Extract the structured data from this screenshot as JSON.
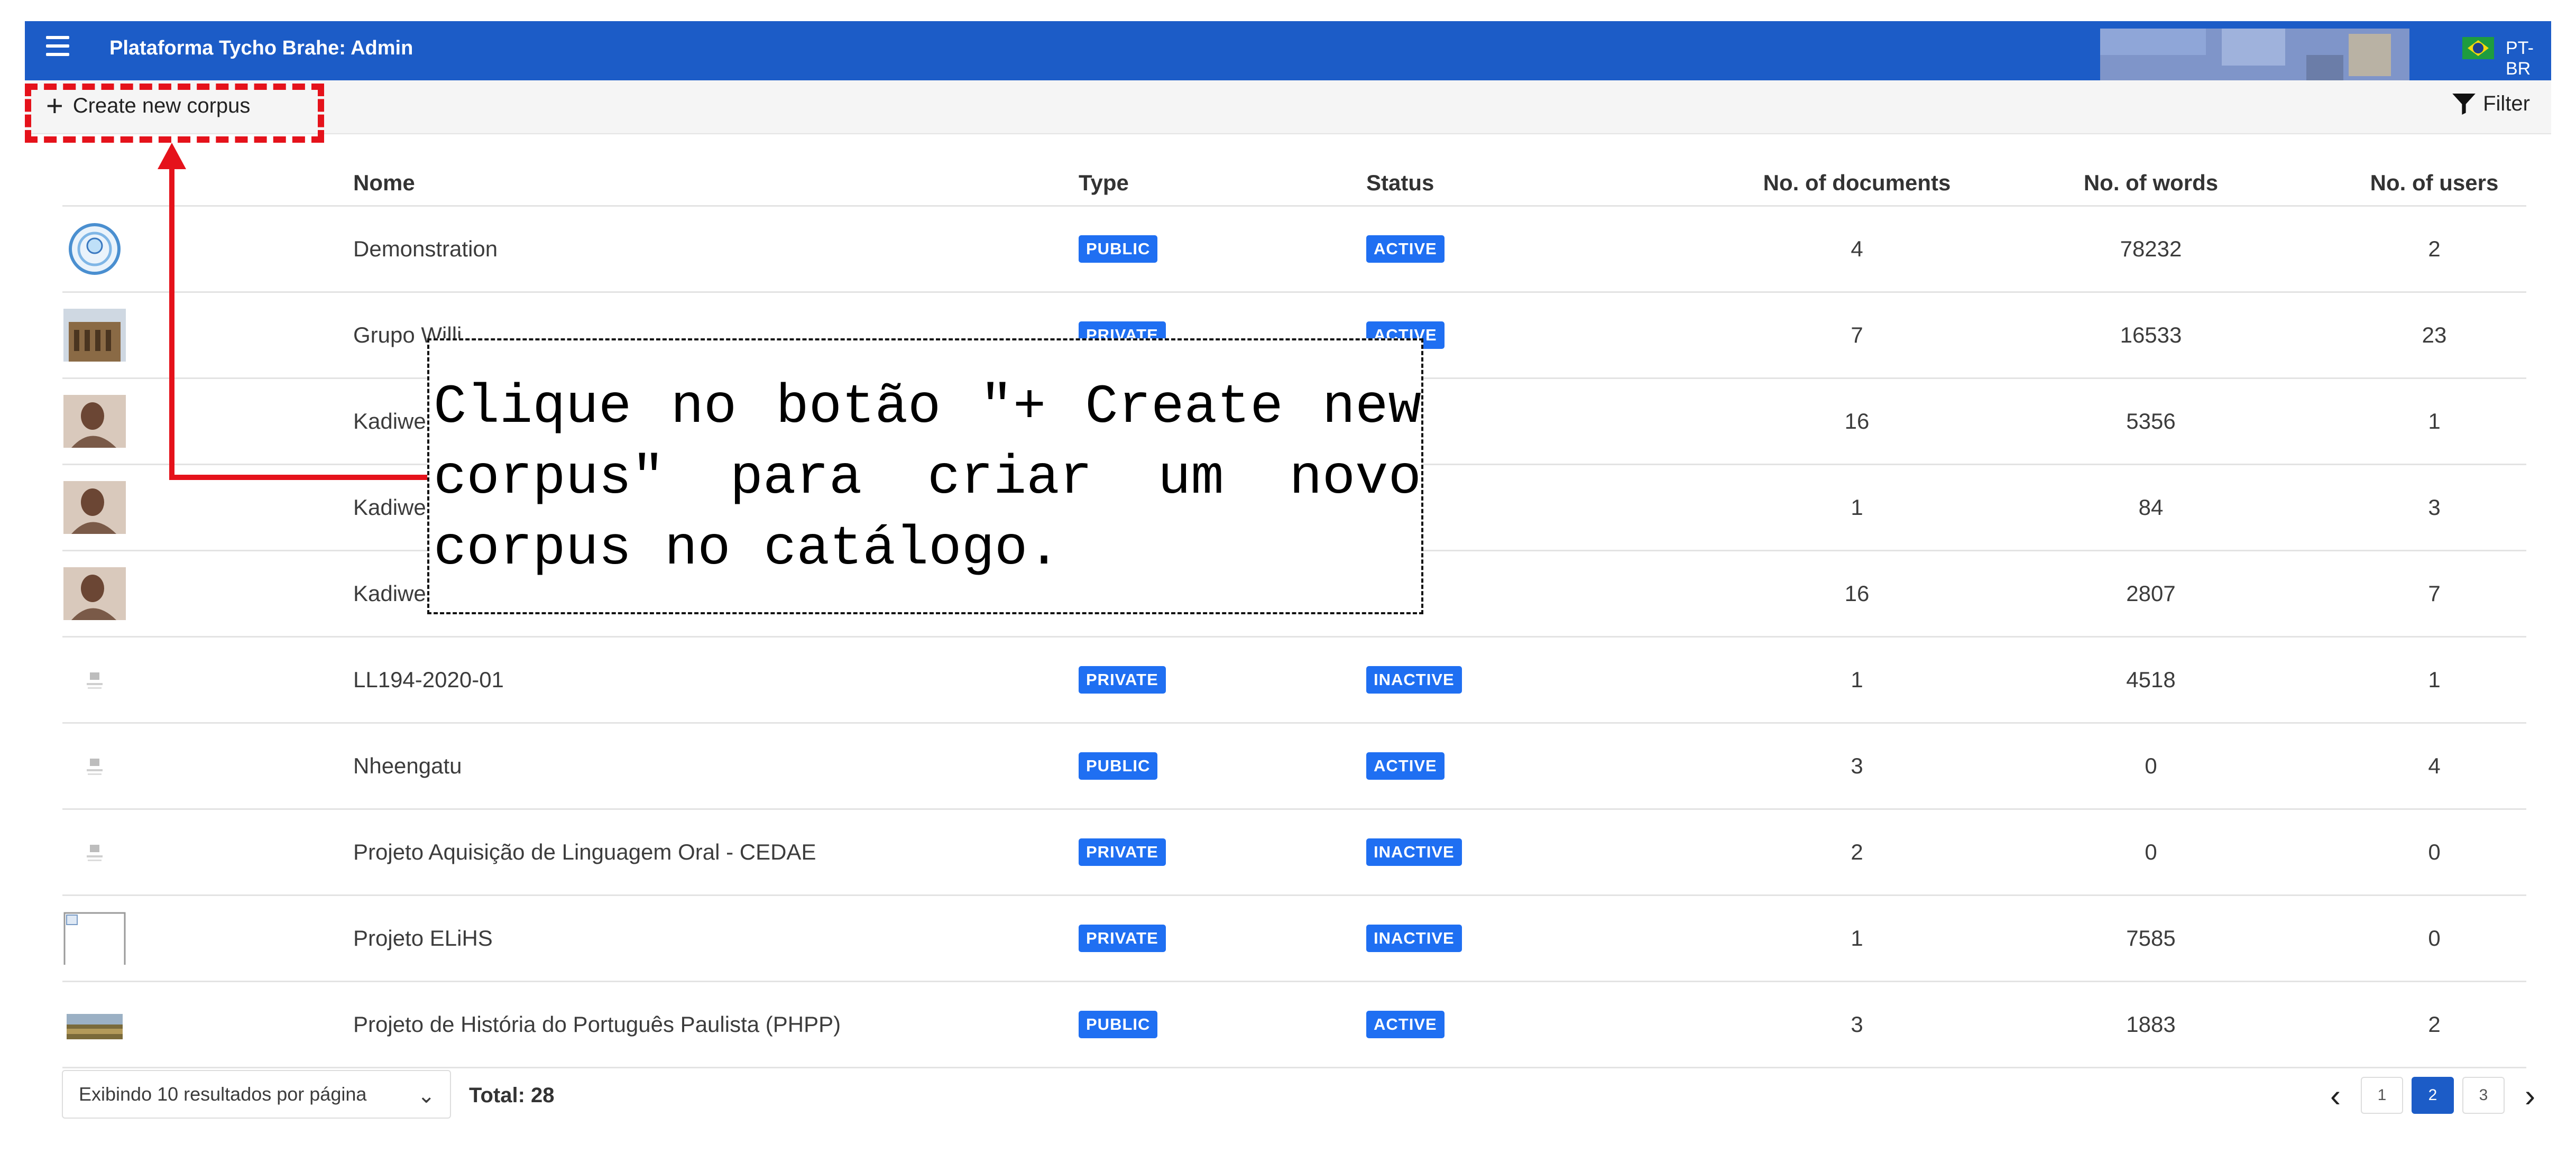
{
  "header": {
    "app_title": "Plataforma Tycho Brahe: Admin",
    "language": "PT-BR",
    "flag_icon": "brazil-flag-icon",
    "menu_icon": "hamburger-icon"
  },
  "toolbar": {
    "create_label": "Create new corpus",
    "filter_label": "Filter"
  },
  "table": {
    "columns": [
      "Nome",
      "Type",
      "Status",
      "No. of documents",
      "No. of words",
      "No. of users"
    ],
    "rows": [
      {
        "name": "Demonstration",
        "type": "PUBLIC",
        "status": "ACTIVE",
        "docs": "4",
        "words": "78232",
        "users": "2",
        "thumb": "spiral-logo"
      },
      {
        "name": "Grupo Willi",
        "type": "PRIVATE",
        "status": "ACTIVE",
        "docs": "7",
        "words": "16533",
        "users": "23",
        "thumb": "building-photo"
      },
      {
        "name": "Kadiwe",
        "type": "",
        "status": "",
        "docs": "16",
        "words": "5356",
        "users": "1",
        "thumb": "portrait-photo"
      },
      {
        "name": "Kadiwe",
        "type": "",
        "status": "",
        "docs": "1",
        "words": "84",
        "users": "3",
        "thumb": "portrait-photo"
      },
      {
        "name": "Kadiwe",
        "type": "",
        "status": "",
        "docs": "16",
        "words": "2807",
        "users": "7",
        "thumb": "portrait-photo"
      },
      {
        "name": "LL194-2020-01",
        "type": "PRIVATE",
        "status": "INACTIVE",
        "docs": "1",
        "words": "4518",
        "users": "1",
        "thumb": "placeholder-logo"
      },
      {
        "name": "Nheengatu",
        "type": "PUBLIC",
        "status": "ACTIVE",
        "docs": "3",
        "words": "0",
        "users": "4",
        "thumb": "placeholder-logo"
      },
      {
        "name": "Projeto Aquisição de Linguagem Oral - CEDAE",
        "type": "PRIVATE",
        "status": "INACTIVE",
        "docs": "2",
        "words": "0",
        "users": "0",
        "thumb": "placeholder-logo"
      },
      {
        "name": "Projeto ELiHS",
        "type": "PRIVATE",
        "status": "INACTIVE",
        "docs": "1",
        "words": "7585",
        "users": "0",
        "thumb": "broken-image"
      },
      {
        "name": "Projeto de História do Português Paulista (PHPP)",
        "type": "PUBLIC",
        "status": "ACTIVE",
        "docs": "3",
        "words": "1883",
        "users": "2",
        "thumb": "landscape-photo"
      }
    ]
  },
  "footer": {
    "per_page": "Exibindo 10 resultados por página",
    "total": "Total: 28",
    "pages": [
      "1",
      "2",
      "3"
    ],
    "current_page": "2"
  },
  "callout": {
    "text": "Clique no botão \"+ Create new corpus\" para criar um novo corpus no catálogo."
  },
  "colors": {
    "topbar": "#1c5cc7",
    "badge": "#1f6ff2",
    "annotation": "#e5121b"
  }
}
